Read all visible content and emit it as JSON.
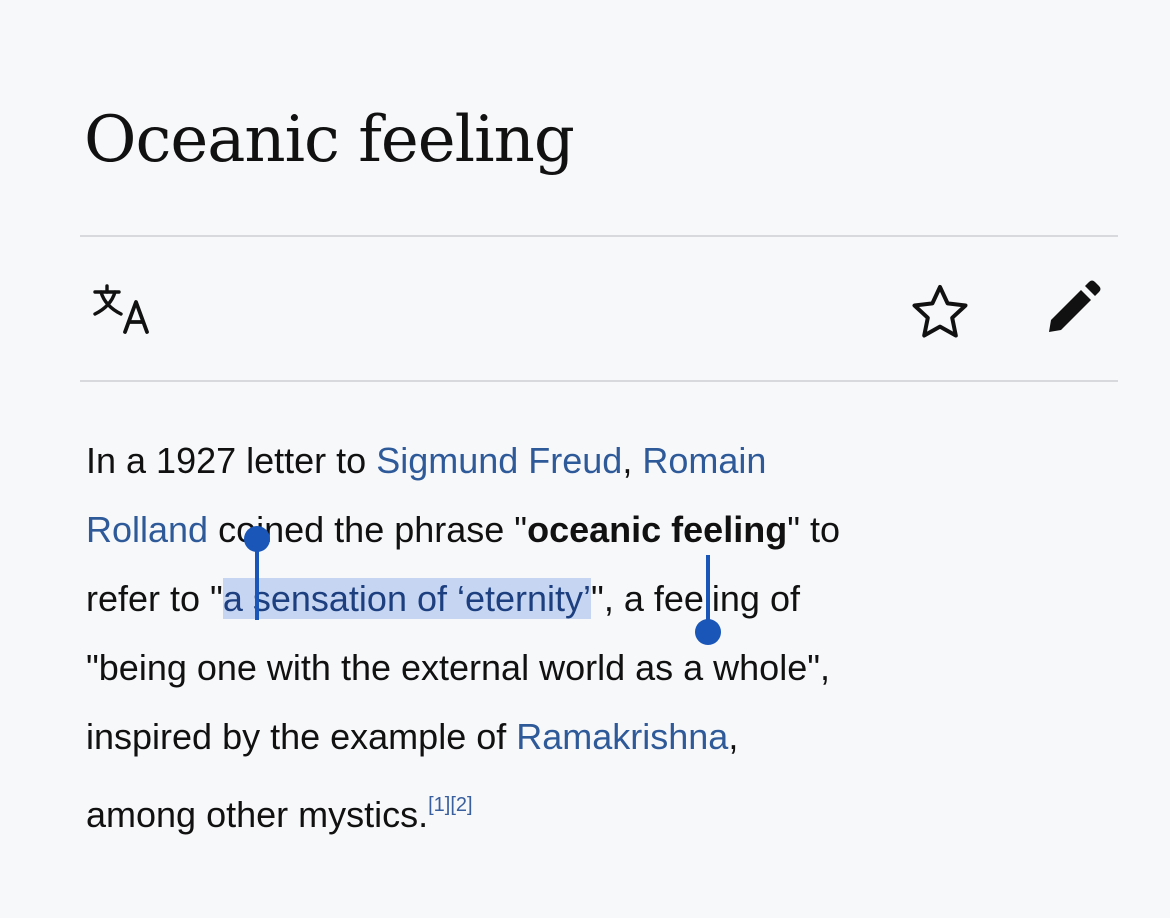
{
  "page": {
    "title": "Oceanic feeling"
  },
  "toolbar": {
    "language_icon": "translate-icon",
    "watch_icon": "star-outline-icon",
    "edit_icon": "pencil-icon"
  },
  "article": {
    "line1": {
      "t1": "In a 1927 letter to ",
      "link_freud": "Sigmund Freud",
      "t2": ", ",
      "link_romain": "Romain"
    },
    "line2": {
      "link_rolland": "Rolland",
      "t1": " coined the phrase \"",
      "bold": "oceanic feeling",
      "t2": "\" to"
    },
    "line3": {
      "t1": "refer to \"",
      "selected": "a sensation of ‘eternity’",
      "t2": "\", a feeling of"
    },
    "line4": {
      "t1": "\"being one with the external world as a whole\","
    },
    "line5": {
      "t1": "inspired by the example of ",
      "link_ramakrishna": "Ramakrishna",
      "t2": ","
    },
    "line6": {
      "t1": "among other mystics.",
      "ref": "[1][2]"
    }
  },
  "colors": {
    "link": "#2f5a99",
    "selection": "#c6d6f2",
    "handle": "#1a56b8",
    "text": "#111111"
  }
}
